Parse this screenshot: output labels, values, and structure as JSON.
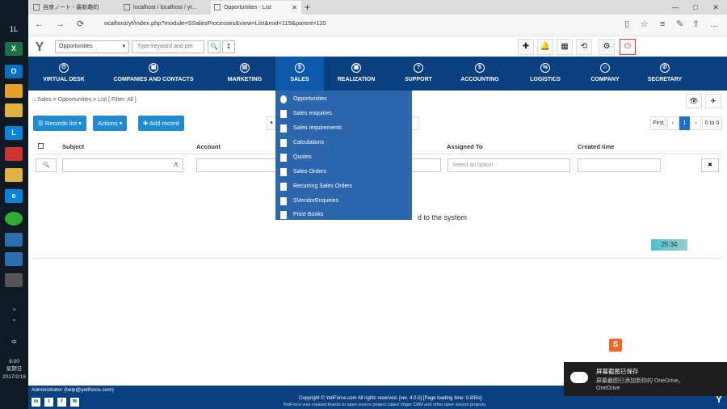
{
  "taskbar": {
    "items": [
      {
        "label": "1L",
        "icon": "app-icon"
      },
      {
        "label": "X",
        "icon": "excel-icon",
        "color": "#1e7145"
      },
      {
        "label": "O",
        "icon": "outlook-icon",
        "color": "#0072c6"
      },
      {
        "label": "",
        "icon": "mail-icon",
        "color": "#e7a12b"
      },
      {
        "label": "",
        "icon": "folder-icon",
        "color": "#e0b040"
      },
      {
        "label": "L",
        "icon": "search-icon",
        "color": "#0a84d8"
      },
      {
        "label": "",
        "icon": "app-icon",
        "color": "#c33"
      },
      {
        "label": "",
        "icon": "files-icon",
        "color": "#e0b040"
      },
      {
        "label": "e",
        "icon": "edge-icon",
        "color": "#0a84d8"
      },
      {
        "label": "",
        "icon": "globe-icon",
        "color": "#3a3"
      },
      {
        "label": "",
        "icon": "app-icon",
        "color": "#2a6fb0"
      },
      {
        "label": "",
        "icon": "app-icon",
        "color": "#2a6fb0"
      },
      {
        "label": "",
        "icon": "app-icon",
        "color": "#555"
      }
    ],
    "tray_chevron": ">",
    "tray_arrows": "^",
    "ime": "中",
    "time": "9:00",
    "day": "星期日",
    "date": "2017/2/16"
  },
  "browser": {
    "tabs": [
      {
        "title": "自席ノート - 最新趣的"
      },
      {
        "title": "localhost / localhost / yt..."
      },
      {
        "title": "Opportunities - List",
        "active": true
      }
    ],
    "newtab": "+",
    "url": "ocalhost/yf/index.php?module=SSalesProcesses&view=List&mid=115&parent=110",
    "controls": {
      "min": "—",
      "max": "□",
      "close": "✕"
    },
    "back": "←",
    "forward": "→",
    "refresh": "⟳",
    "star": "☆",
    "hub": "≡",
    "note": "✎",
    "share": "⇧",
    "more": "…"
  },
  "app": {
    "module_select": "Opportunities",
    "search_placeholder": "Type keyword and pre",
    "search_btn": "🔍",
    "adv_btn": "↧",
    "quick": [
      "✚",
      "🔔",
      "▦",
      "⟲",
      "⚙",
      "⏻"
    ]
  },
  "nav": [
    {
      "label": "VIRTUAL DESK",
      "icon": "⏱"
    },
    {
      "label": "COMPANIES AND CONTACTS",
      "icon": "▦"
    },
    {
      "label": "MARKETING",
      "icon": "▤"
    },
    {
      "label": "SALES",
      "icon": "$",
      "active": true
    },
    {
      "label": "REALIZATION",
      "icon": "▣"
    },
    {
      "label": "SUPPORT",
      "icon": "?"
    },
    {
      "label": "ACCOUNTING",
      "icon": "$"
    },
    {
      "label": "LOGISTICS",
      "icon": "⇆"
    },
    {
      "label": "COMPANY",
      "icon": "☺"
    },
    {
      "label": "SECRETARY",
      "icon": "✆"
    }
  ],
  "breadcrumb": "Sales > Opportunities > List [ Filter: All ]",
  "toolbar": {
    "records_list": "Records list ▾",
    "actions": "Actions ▾",
    "add_record": "✚ Add record",
    "eye": "👁",
    "send": "✈"
  },
  "pagination": {
    "first": "First",
    "prev": "‹",
    "current": "1",
    "next": "›",
    "count": "0 to 0"
  },
  "table": {
    "checkbox": "",
    "headers": [
      "Subject",
      "Account",
      "Assigned To",
      "Created time"
    ],
    "filter_assigned_placeholder": "Select an option",
    "search_icon": "🔍",
    "clear_icon": "✖"
  },
  "dropdown": [
    {
      "label": "Opportunities"
    },
    {
      "label": "Sales enquiries"
    },
    {
      "label": "Sales requirements"
    },
    {
      "label": "Calculations"
    },
    {
      "label": "Quotes"
    },
    {
      "label": "Sales Orders"
    },
    {
      "label": "Recurring Sales Orders"
    },
    {
      "label": "SVendorEnquiries"
    },
    {
      "label": "Price Books"
    }
  ],
  "no_records": "d to the system",
  "timer": "25:34",
  "footer": {
    "user": "Administrator (help@yetiforce.com)",
    "social": [
      "in",
      "t",
      "f",
      "✉"
    ],
    "copy": "Copyright © YetiForce.com All rights reserved. [ver. 4.0.0] [Page loading time: 0.835s]",
    "copy2": "YetiForce was created thanks to open source project called Vtiger CRM and other open source projects."
  },
  "toast": {
    "title": "屏幕截图已保存",
    "line1": "屏幕截图已添加到你的 OneDrive。",
    "line2": "OneDrive"
  },
  "float_icon": "S"
}
